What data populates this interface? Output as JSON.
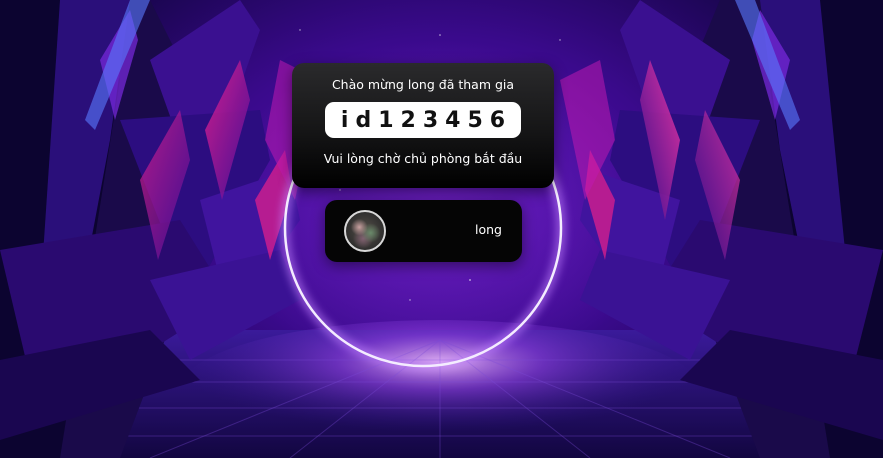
{
  "welcome": {
    "greeting": "Chào mừng long đã tham gia",
    "room_id": "id123456",
    "waiting_message": "Vui lòng chờ chủ phòng bắt đầu"
  },
  "player": {
    "name": "long"
  },
  "colors": {
    "card_background": "#000000",
    "id_box_background": "#ffffff",
    "ring_glow": "#d9c8ff",
    "accent_magenta": "#e81e8c",
    "accent_purple": "#5a12b8"
  }
}
